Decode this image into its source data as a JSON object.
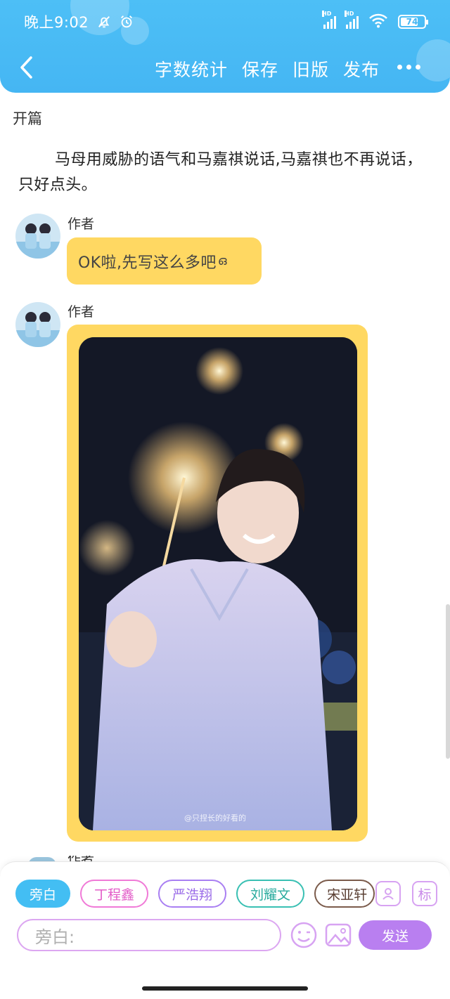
{
  "status_bar": {
    "time": "晚上9:02",
    "battery": "74",
    "battery_level": 0.74,
    "icons": [
      "mute-bell-icon",
      "alarm-icon",
      "hd-signal-icon",
      "hd-signal-icon",
      "wifi-icon",
      "battery-icon"
    ]
  },
  "header": {
    "back_icon": "chevron-left-icon",
    "actions": [
      "字数统计",
      "保存",
      "旧版",
      "发布"
    ],
    "more_icon": "more-dots-icon",
    "color": "#4dbff6"
  },
  "chapter_title": "开篇",
  "narration": "马母用威胁的语气和马嘉祺说话,马嘉祺也不再说话，只好点头。",
  "messages": [
    {
      "author": "作者",
      "text": "OK啦,先写这么多吧",
      "emoji": "ഒ"
    },
    {
      "author": "作者",
      "image_caption": "@只捏长的好看的"
    }
  ],
  "bubble_color": "#ffd862",
  "role_chips": [
    "旁白",
    "丁程鑫",
    "严浩翔",
    "刘耀文",
    "宋亚轩"
  ],
  "tools": {
    "character_icon": "character-card-icon",
    "tag_label": "标"
  },
  "composer": {
    "placeholder": "旁白:",
    "emoji_icon": "emoji-icon",
    "image_icon": "image-icon",
    "send_label": "发送"
  },
  "accent_colors": {
    "active_chip": "#43bef3",
    "send": "#b97ff0"
  }
}
